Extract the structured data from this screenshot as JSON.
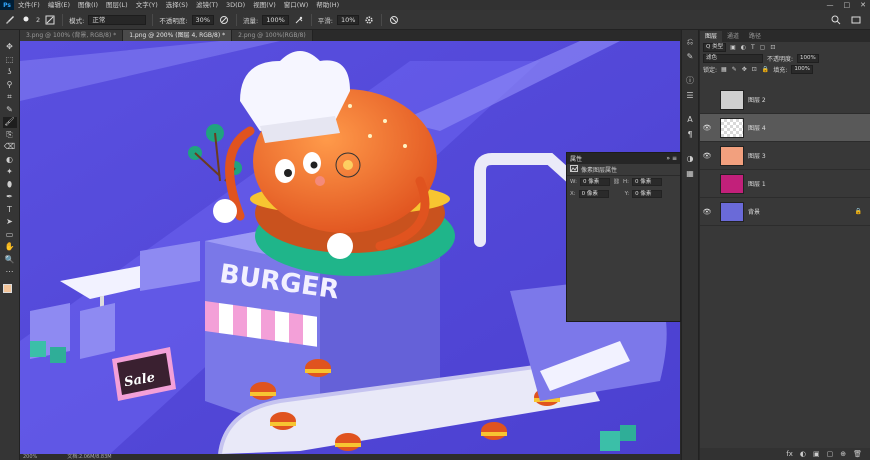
{
  "menubar": {
    "logo": "Ps",
    "items": [
      "文件(F)",
      "编辑(E)",
      "图像(I)",
      "图层(L)",
      "文字(Y)",
      "选择(S)",
      "滤镜(T)",
      "3D(D)",
      "视图(V)",
      "窗口(W)",
      "帮助(H)"
    ],
    "controls": [
      "—",
      "□",
      "✕"
    ]
  },
  "options": {
    "brush_size": "2",
    "mode_label": "模式:",
    "mode_value": "正常",
    "opacity_label": "不透明度:",
    "opacity_value": "30%",
    "flow_label": "流量:",
    "flow_value": "100%",
    "smooth_label": "平滑:",
    "smooth_value": "10%"
  },
  "tabs": [
    {
      "label": "3.png @ 100% (背景, RGB/8) *",
      "active": false
    },
    {
      "label": "1.png @ 200% (图层 4, RGB/8) *",
      "active": true
    },
    {
      "label": "2.png @ 100%(RGB/8)",
      "active": false
    }
  ],
  "toolbar": {
    "tools": [
      "✥",
      "⬚",
      "ʖ",
      "⚲",
      "⌗",
      "✎",
      "🖌",
      "⎘",
      "⌫",
      "◐",
      "✦",
      "⬮",
      "✒",
      "T",
      "➤",
      "▭",
      "✋",
      "🔍",
      "⋯"
    ],
    "active_index": 6,
    "fg_color": "#f4c59a",
    "bg_color": "#ffffff"
  },
  "canvas": {
    "sign_text": "BURGER",
    "sale_text": "Sale",
    "bg_color": "#6a5fe8"
  },
  "status": {
    "zoom": "200%",
    "doc": "文档:2.06M/8.83M"
  },
  "properties": {
    "title": "属性",
    "subtitle": "像素图层属性",
    "w_label": "W:",
    "w_value": "0 像素",
    "h_label": "H:",
    "h_value": "0 像素",
    "x_label": "X:",
    "x_value": "0 像素",
    "y_label": "Y:",
    "y_value": "0 像素"
  },
  "layers_panel": {
    "tabs": [
      "图层",
      "通道",
      "路径"
    ],
    "filter_label": "Q 类型",
    "blend_mode": "滤色",
    "opacity_label": "不透明度:",
    "opacity_value": "100%",
    "lock_label": "锁定:",
    "fill_label": "填充:",
    "fill_value": "100%",
    "layers": [
      {
        "name": "图层 2",
        "visible": false,
        "selected": false,
        "thumb": "#cfcfcf"
      },
      {
        "name": "图层 4",
        "visible": true,
        "selected": true,
        "thumb": "#e8e8e8"
      },
      {
        "name": "图层 3",
        "visible": true,
        "selected": false,
        "thumb": "#f2a07e"
      },
      {
        "name": "图层 1",
        "visible": false,
        "selected": false,
        "thumb": "#c2207a"
      },
      {
        "name": "背景",
        "visible": true,
        "selected": false,
        "thumb": "#6a6ad8"
      }
    ],
    "footer_icons": [
      "fx",
      "◐",
      "▣",
      "▢",
      "⊕",
      "🗑"
    ]
  }
}
